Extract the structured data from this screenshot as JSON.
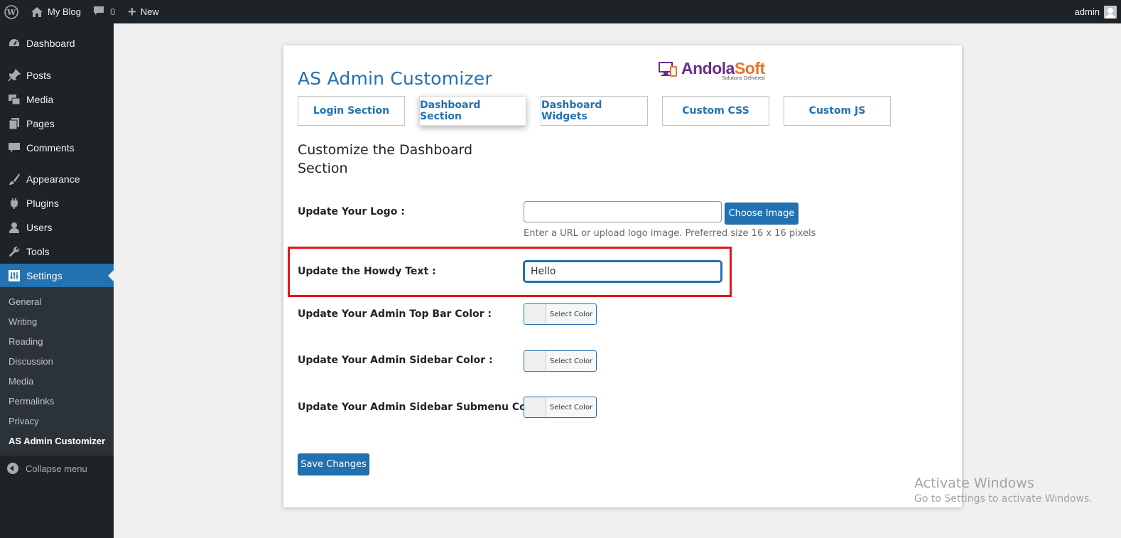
{
  "adminbar": {
    "site_name": "My Blog",
    "comments_count": "0",
    "new_label": "New",
    "account_name": "admin"
  },
  "sidebar": {
    "items": [
      {
        "label": "Dashboard",
        "icon": "dashboard-icon"
      },
      {
        "label": "Posts",
        "icon": "pin-icon"
      },
      {
        "label": "Media",
        "icon": "media-icon"
      },
      {
        "label": "Pages",
        "icon": "pages-icon"
      },
      {
        "label": "Comments",
        "icon": "comment-icon"
      },
      {
        "label": "Appearance",
        "icon": "brush-icon"
      },
      {
        "label": "Plugins",
        "icon": "plugin-icon"
      },
      {
        "label": "Users",
        "icon": "user-icon"
      },
      {
        "label": "Tools",
        "icon": "wrench-icon"
      },
      {
        "label": "Settings",
        "icon": "settings-icon"
      }
    ],
    "submenu": [
      "General",
      "Writing",
      "Reading",
      "Discussion",
      "Media",
      "Permalinks",
      "Privacy",
      "AS Admin Customizer"
    ],
    "collapse_label": "Collapse menu"
  },
  "main": {
    "title": "AS Admin Customizer",
    "brand": {
      "part1": "Andola",
      "part2": "Soft",
      "tagline": "Solutions Delivered"
    },
    "tabs": [
      {
        "label": "Login Section"
      },
      {
        "label": "Dashboard Section"
      },
      {
        "label": "Dashboard Widgets"
      },
      {
        "label": "Custom CSS"
      },
      {
        "label": "Custom JS"
      }
    ],
    "section_heading": "Customize the Dashboard Section",
    "logo": {
      "label": "Update Your Logo :",
      "value": "",
      "button": "Choose Image",
      "help": "Enter a URL or upload logo image. Preferred size 16 x 16 pixels"
    },
    "howdy": {
      "label": "Update the Howdy Text :",
      "value": "Hello"
    },
    "colors": [
      {
        "label": "Update Your Admin Top Bar Color :",
        "button": "Select Color"
      },
      {
        "label": "Update Your Admin Sidebar Color :",
        "button": "Select Color"
      },
      {
        "label": "Update Your Admin Sidebar Submenu Color :",
        "button": "Select Color"
      }
    ],
    "save_label": "Save Changes"
  },
  "watermark": {
    "line1": "Activate Windows",
    "line2": "Go to Settings to activate Windows."
  },
  "colors": {
    "adminbar": "#1d2327",
    "accent": "#2271b1",
    "highlight": "#e3151a",
    "brand_purple": "#6b2d8c",
    "brand_orange": "#e8732a"
  }
}
